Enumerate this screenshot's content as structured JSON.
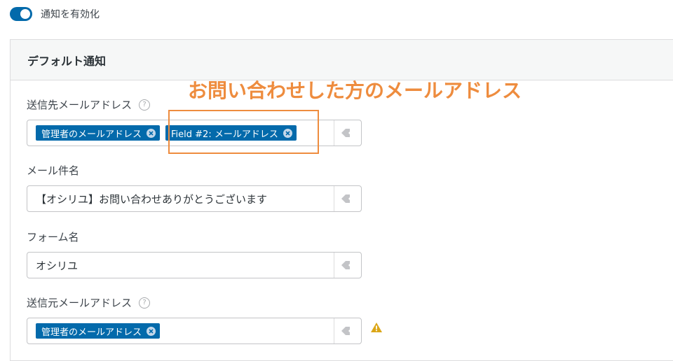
{
  "toggle": {
    "label": "通知を有効化",
    "checked": true
  },
  "panel": {
    "title": "デフォルト通知"
  },
  "annotation": {
    "text": "お問い合わせした方のメールアドレス"
  },
  "fields": {
    "send_to": {
      "label": "送信先メールアドレス",
      "chips": [
        "管理者のメールアドレス",
        "Field #2: メールアドレス"
      ]
    },
    "subject": {
      "label": "メール件名",
      "value": "【オシリユ】お問い合わせありがとうございます"
    },
    "from_name": {
      "label": "フォーム名",
      "value": "オシリユ"
    },
    "from_email": {
      "label": "送信元メールアドレス",
      "chips": [
        "管理者のメールアドレス"
      ]
    }
  },
  "help_glyph": "?",
  "colors": {
    "accent": "#036aab",
    "annotation": "#ee8c3e",
    "warning": "#dba617"
  },
  "icons": {
    "tag": "tag-icon",
    "remove": "remove-chip-icon",
    "warning": "warning-icon",
    "help": "help-icon"
  }
}
